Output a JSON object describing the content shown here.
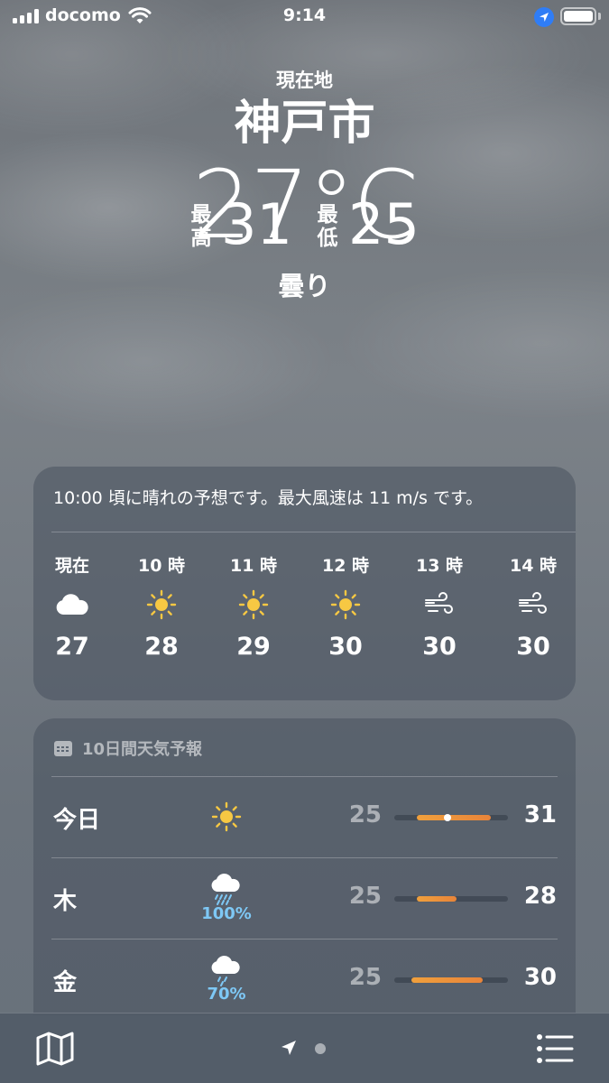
{
  "status_bar": {
    "carrier": "docomo",
    "time": "9:14",
    "icons": [
      "signal-icon",
      "wifi-icon",
      "location-arrow-icon",
      "battery-icon"
    ]
  },
  "header": {
    "location_label": "現在地",
    "city": "神戸市",
    "temperature": "27°C",
    "high_label": "最高",
    "high_value": "31",
    "low_label": "最低",
    "low_value": "25",
    "condition": "曇り"
  },
  "hourly": {
    "summary": "10:00 頃に晴れの予想です。最大風速は 11 m/s です。",
    "hours": [
      {
        "label": "現在",
        "icon": "cloud-icon",
        "temp": "27"
      },
      {
        "label": "10 時",
        "icon": "sun-icon",
        "temp": "28"
      },
      {
        "label": "11 時",
        "icon": "sun-icon",
        "temp": "29"
      },
      {
        "label": "12 時",
        "icon": "sun-icon",
        "temp": "30"
      },
      {
        "label": "13 時",
        "icon": "wind-icon",
        "temp": "30"
      },
      {
        "label": "14 時",
        "icon": "wind-icon",
        "temp": "30"
      }
    ]
  },
  "daily": {
    "header": "10日間天気予報",
    "header_icon": "calendar-icon",
    "days": [
      {
        "name": "今日",
        "icon": "sun-icon",
        "precip": "",
        "low": "25",
        "high": "31",
        "range_start": 0.2,
        "range_end": 0.85,
        "current": 0.47
      },
      {
        "name": "木",
        "icon": "rain-cloud-icon",
        "precip": "100%",
        "low": "25",
        "high": "28",
        "range_start": 0.2,
        "range_end": 0.55
      },
      {
        "name": "金",
        "icon": "rain-cloud-icon",
        "precip": "70%",
        "low": "25",
        "high": "30",
        "range_start": 0.15,
        "range_end": 0.78
      }
    ]
  },
  "colors": {
    "sun": "#f7c843",
    "precip": "#7ec8f5",
    "bar_start": "#f0a03c",
    "bar_end": "#e8843a",
    "location_dot": "#2f7df6"
  },
  "toolbar": {
    "icons": [
      "map-icon",
      "location-arrow-icon",
      "page-dot",
      "list-icon"
    ]
  }
}
